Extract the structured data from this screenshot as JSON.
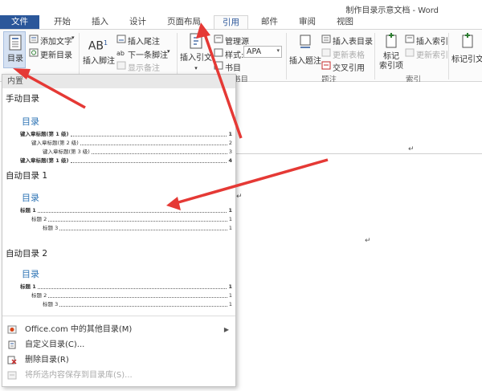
{
  "window": {
    "title": "制作目录示意文档 - Word"
  },
  "tabs": [
    {
      "label": "文件"
    },
    {
      "label": "开始"
    },
    {
      "label": "插入"
    },
    {
      "label": "设计"
    },
    {
      "label": "页面布局"
    },
    {
      "label": "引用"
    },
    {
      "label": "邮件"
    },
    {
      "label": "审阅"
    },
    {
      "label": "视图"
    }
  ],
  "active_tab": "引用",
  "ribbon": {
    "toc_button": "目录",
    "add_text": "添加文字",
    "update_toc": "更新目录",
    "insert_footnote": "插入脚注",
    "insert_endnote": "插入尾注",
    "next_footnote": "下一条脚注",
    "show_notes": "显示备注",
    "insert_citation": "插入引文",
    "manage_sources": "管理源",
    "style_label": "样式:",
    "style_value": "APA",
    "bibliography": "书目",
    "group_citations": "书目",
    "insert_caption": "插入题注",
    "insert_table_of_figures": "插入表目录",
    "update_table": "更新表格",
    "cross_reference": "交叉引用",
    "group_captions": "题注",
    "mark_entry_line1": "标记",
    "mark_entry_line2": "索引项",
    "insert_index": "插入索引",
    "update_index": "更新索引",
    "group_index": "索引",
    "mark_citation": "标记引文"
  },
  "gallery": {
    "builtin_header": "内置",
    "manual": {
      "title": "手动目录",
      "heading": "目录",
      "lines": [
        {
          "label": "键入章标题(第 1 级)",
          "page": "1"
        },
        {
          "label": "键入章标题(第 2 级)",
          "page": "2"
        },
        {
          "label": "键入章标题(第 3 级)",
          "page": "3"
        },
        {
          "label": "键入章标题(第 1 级)",
          "page": "4"
        }
      ]
    },
    "auto1": {
      "title": "自动目录 1",
      "heading": "目录",
      "lines": [
        {
          "label": "标题 1",
          "page": "1"
        },
        {
          "label": "标题 2",
          "page": "1"
        },
        {
          "label": "标题 3",
          "page": "1"
        }
      ]
    },
    "auto2": {
      "title": "自动目录 2",
      "heading": "目录",
      "lines": [
        {
          "label": "标题 1",
          "page": "1"
        },
        {
          "label": "标题 2",
          "page": "1"
        },
        {
          "label": "标题 3",
          "page": "1"
        }
      ]
    },
    "menu": [
      {
        "label": "Office.com 中的其他目录(M)",
        "icon": "office-icon",
        "has_submenu": true,
        "enabled": true
      },
      {
        "label": "自定义目录(C)...",
        "icon": "custom-toc-icon",
        "has_submenu": false,
        "enabled": true
      },
      {
        "label": "删除目录(R)",
        "icon": "remove-toc-icon",
        "has_submenu": false,
        "enabled": true
      },
      {
        "label": "将所选内容保存到目录库(S)...",
        "icon": "save-selection-icon",
        "has_submenu": false,
        "enabled": false
      }
    ]
  },
  "colors": {
    "file_tab": "#2b579a",
    "accent_text": "#2b579a",
    "toc_heading": "#2e74b5",
    "annotation_arrow": "#e53935"
  }
}
